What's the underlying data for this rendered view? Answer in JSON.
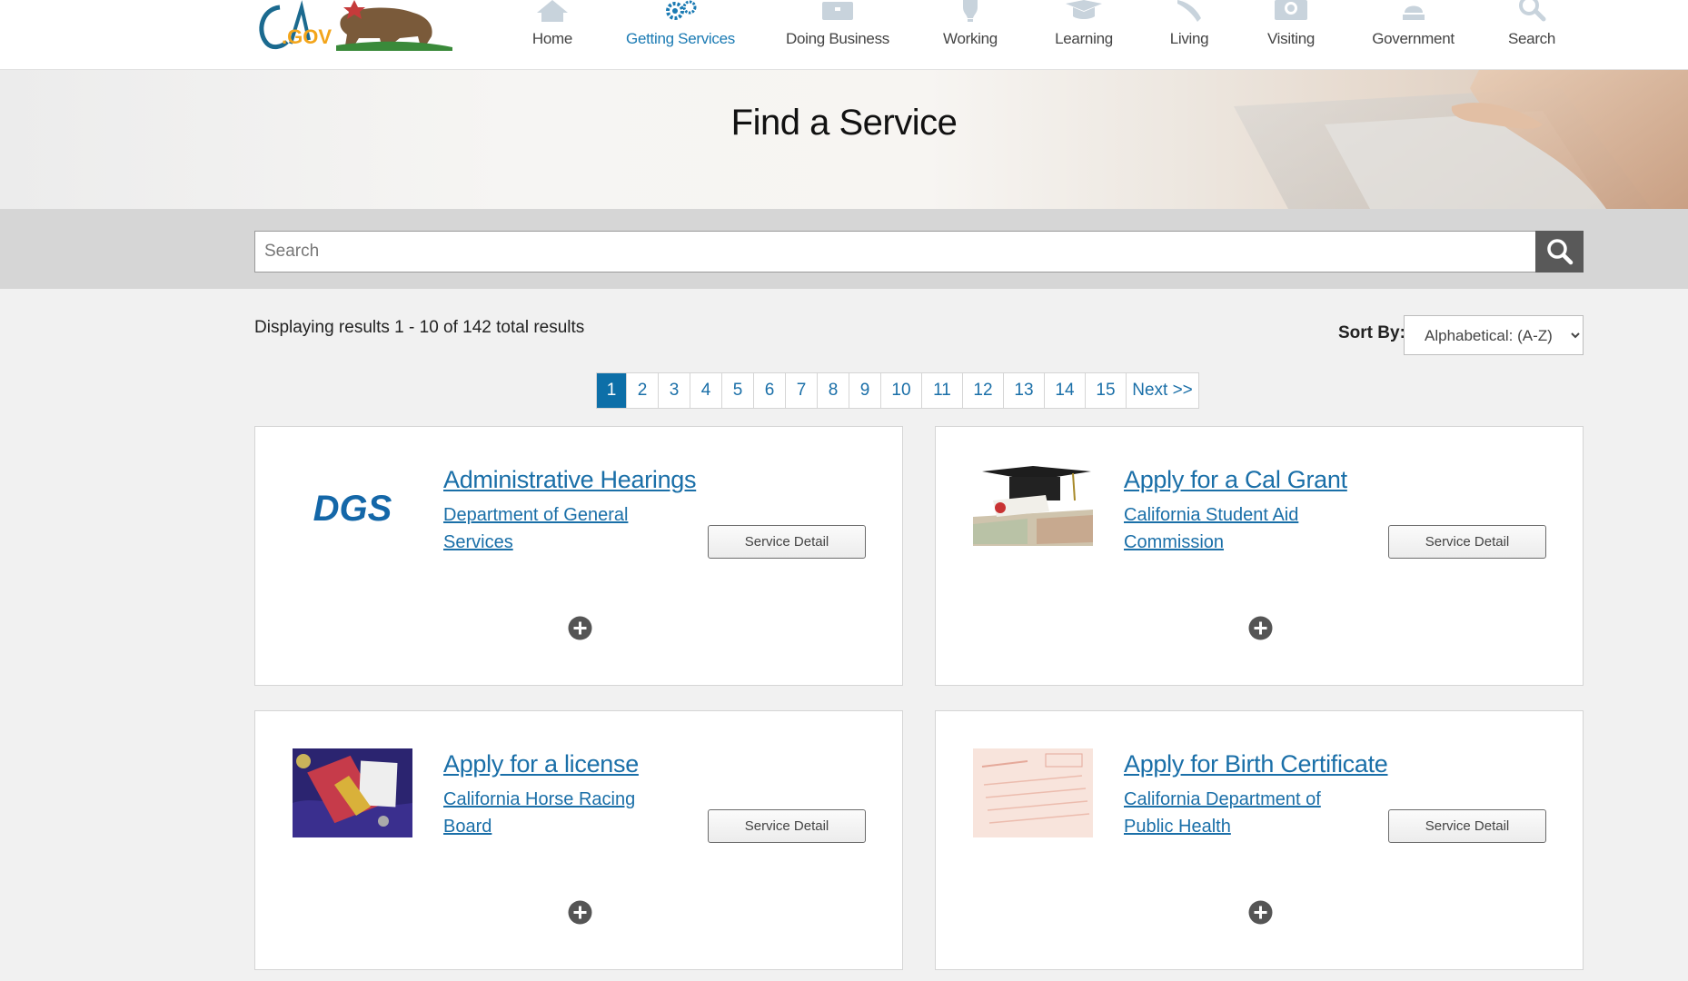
{
  "nav": {
    "items": [
      {
        "label": "Home",
        "icon": "home-icon"
      },
      {
        "label": "Getting Services",
        "icon": "gears-icon"
      },
      {
        "label": "Doing Business",
        "icon": "briefcase-icon"
      },
      {
        "label": "Working",
        "icon": "lightbulb-icon"
      },
      {
        "label": "Learning",
        "icon": "graduation-cap-icon"
      },
      {
        "label": "Living",
        "icon": "leaf-icon"
      },
      {
        "label": "Visiting",
        "icon": "camera-icon"
      },
      {
        "label": "Government",
        "icon": "capitol-icon"
      },
      {
        "label": "Search",
        "icon": "search-icon"
      }
    ],
    "active": "Getting Services",
    "accent_color": "#1a7ab3"
  },
  "logo": {
    "text": ".GOV",
    "initials": "CA"
  },
  "hero": {
    "title": "Find a Service"
  },
  "search": {
    "placeholder": "Search"
  },
  "results": {
    "summary": "Displaying results 1 - 10 of 142 total results"
  },
  "sort": {
    "label": "Sort By:",
    "selected": "Alphabetical: (A-Z)"
  },
  "pagination": {
    "pages": [
      "1",
      "2",
      "3",
      "4",
      "5",
      "6",
      "7",
      "8",
      "9",
      "10",
      "11",
      "12",
      "13",
      "14",
      "15"
    ],
    "current": "1",
    "next_label": "Next >>"
  },
  "cards": [
    {
      "title": "Administrative Hearings",
      "agency": "Department of General Services",
      "button": "Service Detail",
      "image": "dgs-logo",
      "logo_text": "DGS"
    },
    {
      "title": "Apply for a Cal Grant",
      "agency": "California Student Aid Commission",
      "button": "Service Detail",
      "image": "graduation-cap-money-photo"
    },
    {
      "title": "Apply for a license",
      "agency": "California Horse Racing Board",
      "button": "Service Detail",
      "image": "license-badge-photo"
    },
    {
      "title": "Apply for Birth Certificate",
      "agency": "California Department of Public Health",
      "button": "Service Detail",
      "image": "birth-certificate-photo"
    }
  ]
}
